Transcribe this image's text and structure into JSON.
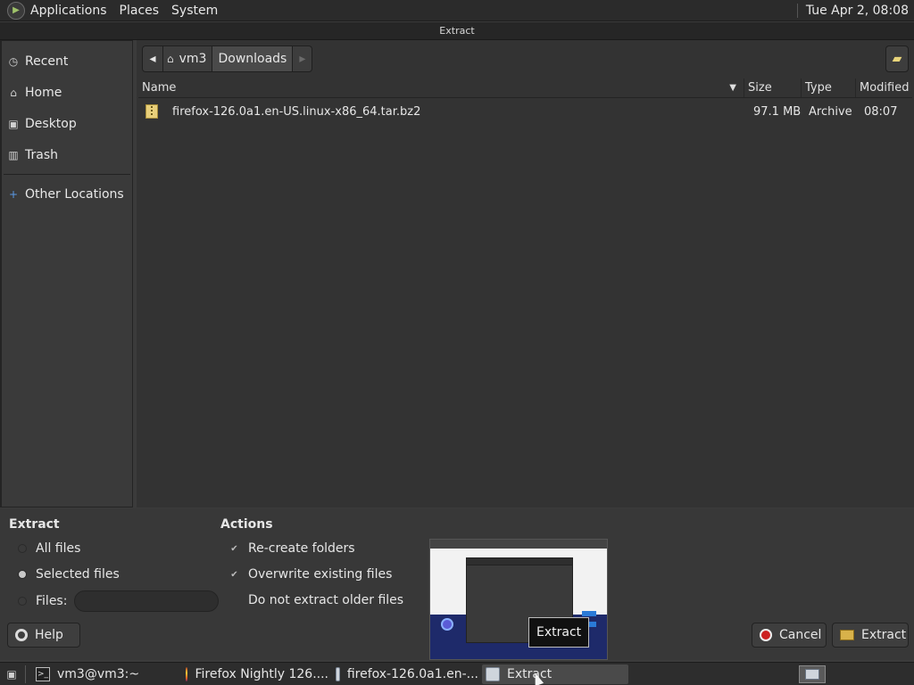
{
  "top_panel": {
    "menus": [
      "Applications",
      "Places",
      "System"
    ],
    "clock": "Tue Apr  2, 08:08"
  },
  "window": {
    "title": "Extract"
  },
  "sidebar": {
    "items": [
      {
        "label": "Recent",
        "icon": "clock-icon"
      },
      {
        "label": "Home",
        "icon": "home-icon"
      },
      {
        "label": "Desktop",
        "icon": "desktop-icon"
      },
      {
        "label": "Trash",
        "icon": "trash-icon"
      },
      {
        "label": "Other Locations",
        "icon": "plus-icon"
      }
    ]
  },
  "pathbar": {
    "home": "vm3",
    "current": "Downloads"
  },
  "file_list": {
    "columns": [
      "Name",
      "Size",
      "Type",
      "Modified"
    ],
    "rows": [
      {
        "name": "firefox-126.0a1.en-US.linux-x86_64.tar.bz2",
        "size": "97.1 MB",
        "type": "Archive",
        "modified": "08:07"
      }
    ]
  },
  "extract_section": {
    "title": "Extract",
    "all_files": "All files",
    "selected_files": "Selected files",
    "files_label": "Files:",
    "files_value": "",
    "selected": "Selected files"
  },
  "actions_section": {
    "title": "Actions",
    "recreate": "Re-create folders",
    "recreate_checked": true,
    "overwrite": "Overwrite existing files",
    "overwrite_checked": true,
    "older": "Do not extract older files",
    "older_checked": false
  },
  "buttons": {
    "help": "Help",
    "cancel": "Cancel",
    "extract": "Extract"
  },
  "tooltip": "Extract",
  "taskbar": {
    "tasks": [
      {
        "label": "vm3@vm3:~",
        "icon": "terminal-icon",
        "active": false
      },
      {
        "label": "Firefox Nightly 126....",
        "icon": "firefox-icon",
        "active": false
      },
      {
        "label": "firefox-126.0a1.en-...",
        "icon": "archive-icon",
        "active": false
      },
      {
        "label": "Extract",
        "icon": "archive-icon",
        "active": true
      }
    ]
  },
  "colors": {
    "panel_bg": "#2b2b2b",
    "window_bg": "#383838",
    "cancel_red": "#cc2222",
    "archive_yellow": "#e8cf7a"
  }
}
